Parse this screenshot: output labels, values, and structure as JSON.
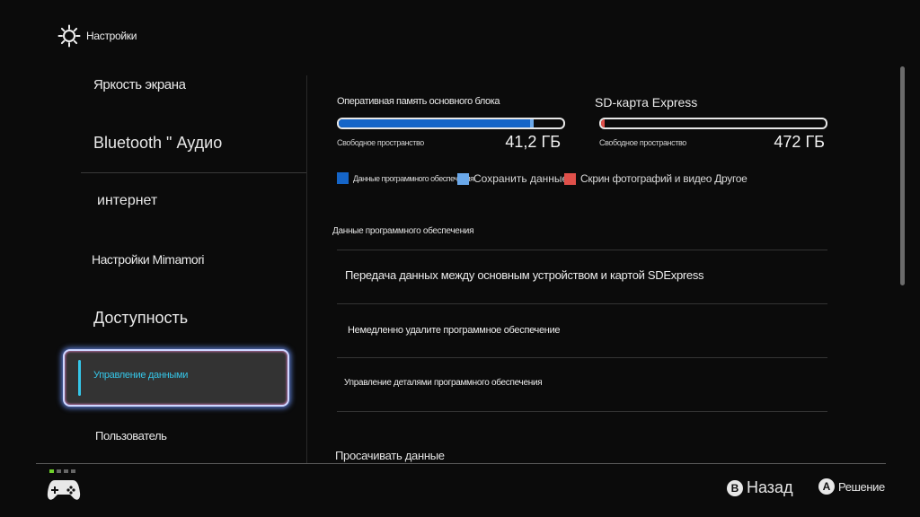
{
  "header": {
    "title": "Настройки",
    "icon": "gear-icon"
  },
  "sidebar": {
    "items": [
      {
        "label": "Яркость экрана"
      },
      {
        "label": "Bluetooth \" Аудио"
      },
      {
        "label": "интернет"
      },
      {
        "label": "Настройки Mimamori"
      },
      {
        "label": "Доступность"
      },
      {
        "label": "Управление данными",
        "selected": true
      },
      {
        "label": "Пользователь"
      }
    ]
  },
  "storage": {
    "internal": {
      "label": "Оперативная память основного блока",
      "free_label": "Свободное пространство",
      "free_value": "41,2 ГБ",
      "used_fraction": 0.85
    },
    "sd": {
      "label": "SD-карта Express",
      "free_label": "Свободное пространство",
      "free_value": "472 ГБ",
      "used_fraction": 0.01
    },
    "legend": [
      {
        "label": "Данные программного обеспечения",
        "color": "#1565c8"
      },
      {
        "label": "Сохранить данные",
        "color": "#6aa8ea"
      },
      {
        "label": "Скрин фотографий и видео Другое",
        "color": "#e0504a"
      }
    ]
  },
  "software_section": {
    "title": "Данные программного обеспечения",
    "rows": [
      {
        "label": "Передача данных между основным устройством и картой SDExpress"
      },
      {
        "label": "Немедленно удалите программное обеспечение"
      },
      {
        "label": "Управление деталями программного обеспечения"
      }
    ]
  },
  "browse_section": {
    "title": "Просачивать данные"
  },
  "footer": {
    "back": {
      "key": "B",
      "label": "Назад"
    },
    "confirm": {
      "key": "A",
      "label": "Решение"
    },
    "controller_icon": "gamepad-icon"
  },
  "colors": {
    "accent": "#35c6e8",
    "used": "#1565c8",
    "save": "#6aa8ea",
    "media": "#e0504a",
    "indicator_on": "#6ed02a"
  }
}
